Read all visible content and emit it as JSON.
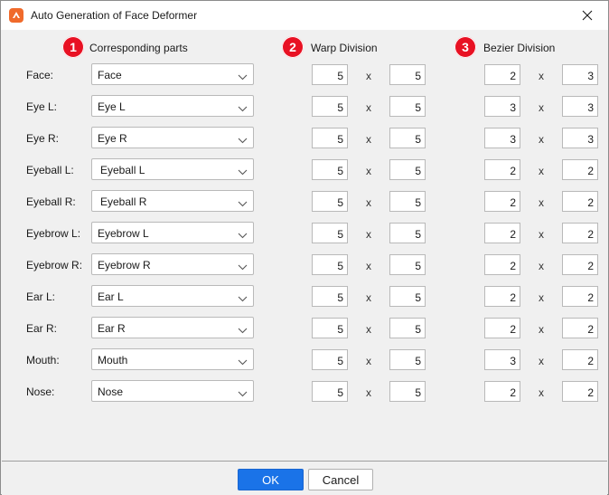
{
  "window": {
    "title": "Auto Generation of Face Deformer"
  },
  "headers": {
    "corresponding": {
      "num": "1",
      "label": "Corresponding parts"
    },
    "warp": {
      "num": "2",
      "label": "Warp Division"
    },
    "bezier": {
      "num": "3",
      "label": "Bezier Division"
    }
  },
  "multiply_symbol": "x",
  "rows": [
    {
      "label": "Face:",
      "part": "Face",
      "warp": [
        "5",
        "5"
      ],
      "bezier": [
        "2",
        "3"
      ]
    },
    {
      "label": "Eye L:",
      "part": "Eye L",
      "warp": [
        "5",
        "5"
      ],
      "bezier": [
        "3",
        "3"
      ]
    },
    {
      "label": "Eye R:",
      "part": "Eye R",
      "warp": [
        "5",
        "5"
      ],
      "bezier": [
        "3",
        "3"
      ]
    },
    {
      "label": "Eyeball L:",
      "part": "Eyeball L",
      "warp": [
        "5",
        "5"
      ],
      "bezier": [
        "2",
        "2"
      ]
    },
    {
      "label": "Eyeball R:",
      "part": "Eyeball R",
      "warp": [
        "5",
        "5"
      ],
      "bezier": [
        "2",
        "2"
      ]
    },
    {
      "label": "Eyebrow L:",
      "part": "Eyebrow L",
      "warp": [
        "5",
        "5"
      ],
      "bezier": [
        "2",
        "2"
      ]
    },
    {
      "label": "Eyebrow R:",
      "part": "Eyebrow R",
      "warp": [
        "5",
        "5"
      ],
      "bezier": [
        "2",
        "2"
      ]
    },
    {
      "label": "Ear L:",
      "part": "Ear L",
      "warp": [
        "5",
        "5"
      ],
      "bezier": [
        "2",
        "2"
      ]
    },
    {
      "label": "Ear R:",
      "part": "Ear R",
      "warp": [
        "5",
        "5"
      ],
      "bezier": [
        "2",
        "2"
      ]
    },
    {
      "label": "Mouth:",
      "part": "Mouth",
      "warp": [
        "5",
        "5"
      ],
      "bezier": [
        "3",
        "2"
      ]
    },
    {
      "label": "Nose:",
      "part": "Nose",
      "warp": [
        "5",
        "5"
      ],
      "bezier": [
        "2",
        "2"
      ]
    }
  ],
  "buttons": {
    "ok": "OK",
    "cancel": "Cancel"
  },
  "colors": {
    "badge": "#e81123",
    "accent": "#1a73e8",
    "app_icon": "#f06a2b"
  },
  "icons": {
    "app": "app-logo-icon",
    "close": "close-icon",
    "dropdown": "chevron-down-icon"
  }
}
